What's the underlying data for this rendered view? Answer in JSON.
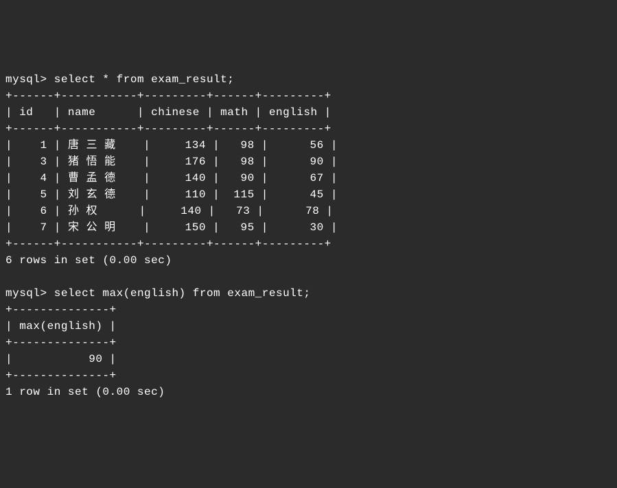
{
  "prompt": "mysql>",
  "query1": {
    "command": "select * from exam_result;",
    "columns": [
      "id",
      "name",
      "chinese",
      "math",
      "english"
    ],
    "separator_top": "+------+-----------+---------+------+---------+",
    "header_row": "| id   | name      | chinese | math | english |",
    "separator_mid": "+------+-----------+---------+------+---------+",
    "rows": [
      {
        "id": "1",
        "name": "唐 三 藏",
        "chinese": "134",
        "math": "98",
        "english": "56"
      },
      {
        "id": "3",
        "name": "猪 悟 能",
        "chinese": "176",
        "math": "98",
        "english": "90"
      },
      {
        "id": "4",
        "name": "曹 孟 德",
        "chinese": "140",
        "math": "90",
        "english": "67"
      },
      {
        "id": "5",
        "name": "刘 玄 德",
        "chinese": "110",
        "math": "115",
        "english": "45"
      },
      {
        "id": "6",
        "name": "孙 权",
        "chinese": "140",
        "math": "73",
        "english": "78"
      },
      {
        "id": "7",
        "name": "宋 公 明",
        "chinese": "150",
        "math": "95",
        "english": "30"
      }
    ],
    "separator_bot": "+------+-----------+---------+------+---------+",
    "result_msg": "6 rows in set (0.00 sec)"
  },
  "query2": {
    "command": "select max(english) from exam_result;",
    "separator_top": "+--------------+",
    "header_row": "| max(english) |",
    "separator_mid": "+--------------+",
    "row": "|           90 |",
    "separator_bot": "+--------------+",
    "result_msg": "1 row in set (0.00 sec)"
  }
}
